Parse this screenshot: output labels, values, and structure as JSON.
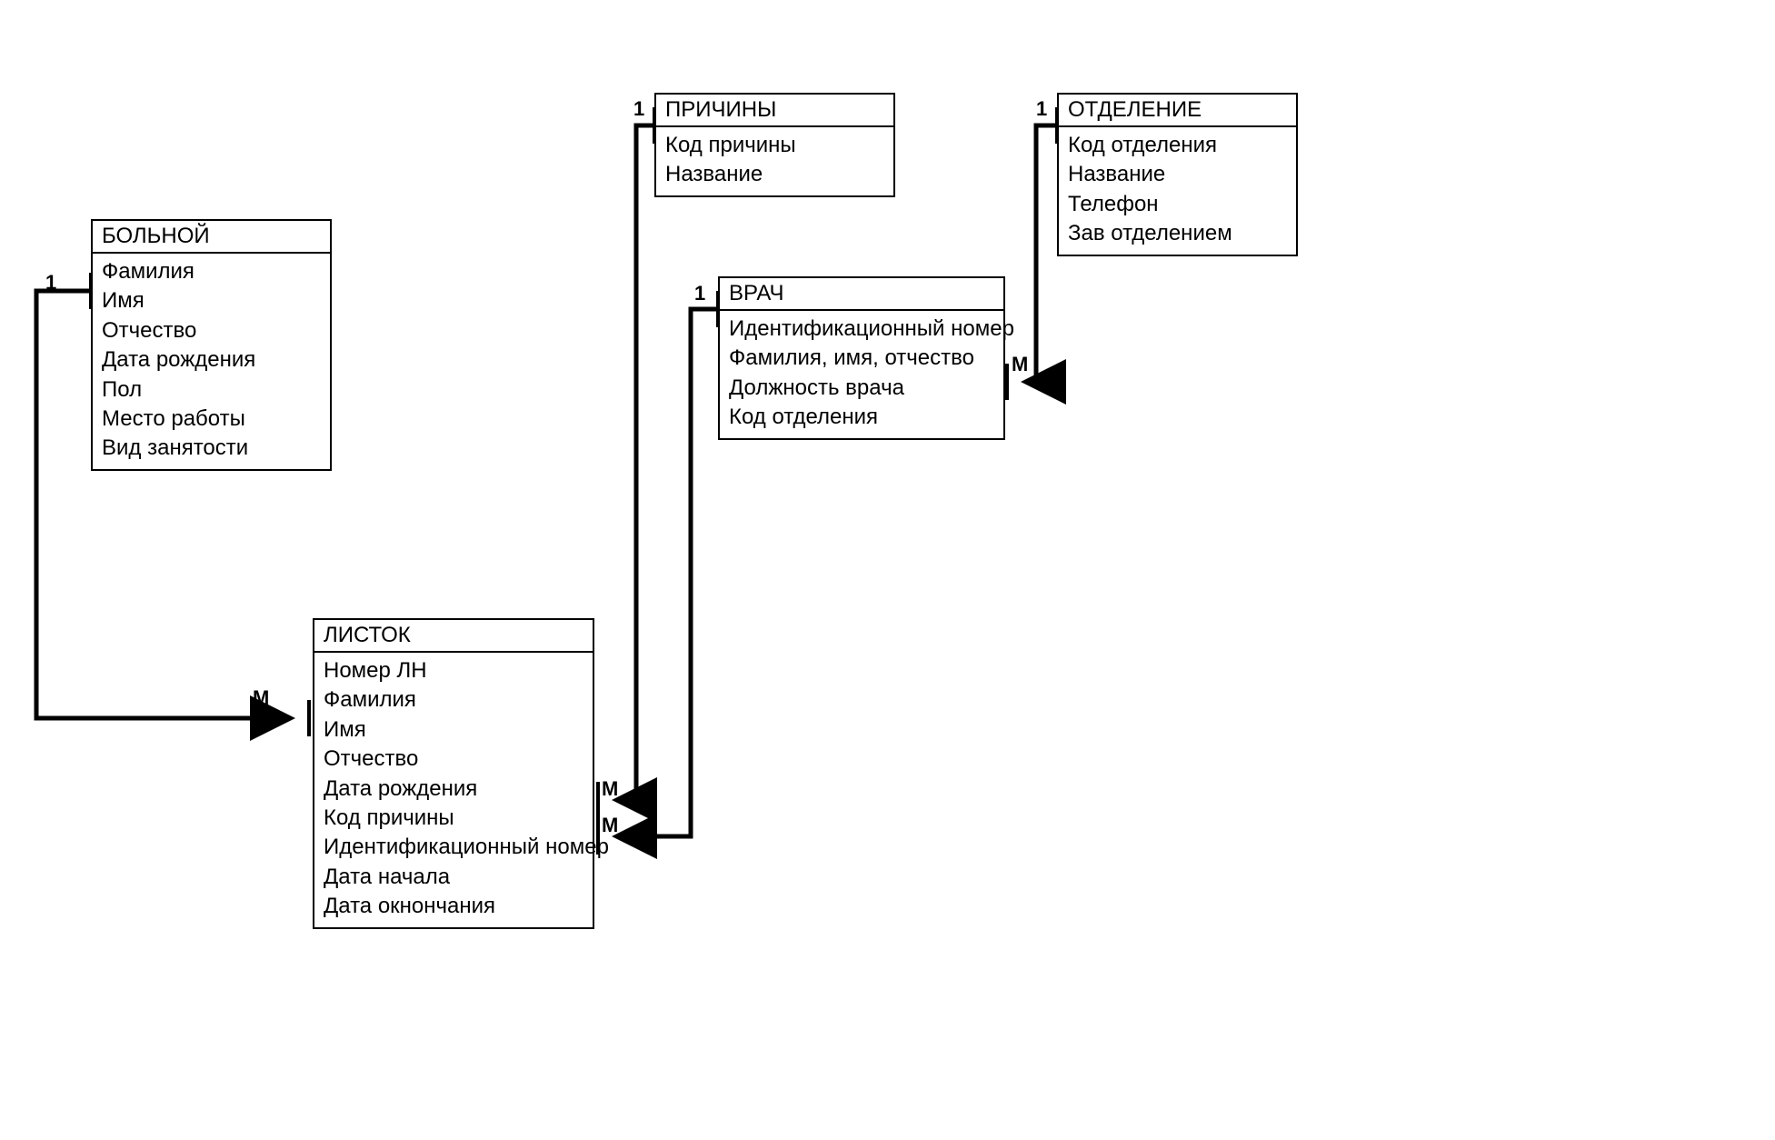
{
  "entities": {
    "bolnoy": {
      "title": "БОЛЬНОЙ",
      "attrs": [
        "Фамилия",
        "Имя",
        "Отчество",
        "Дата рождения",
        "Пол",
        "Место работы",
        "Вид занятости"
      ]
    },
    "prichiny": {
      "title": "ПРИЧИНЫ",
      "attrs": [
        "Код причины",
        "Название"
      ]
    },
    "otdelenie": {
      "title": "ОТДЕЛЕНИЕ",
      "attrs": [
        "Код отделения",
        "Название",
        "Телефон",
        "Зав отделением"
      ]
    },
    "vrach": {
      "title": "ВРАЧ",
      "attrs": [
        "Идентификационный номер",
        "Фамилия, имя, отчество",
        "Должность врача",
        "Код отделения"
      ]
    },
    "listok": {
      "title": "ЛИСТОК",
      "attrs": [
        "Номер ЛН",
        "Фамилия",
        "Имя",
        "Отчество",
        "Дата рождения",
        "Код причины",
        "Идентификационный номер",
        "Дата начала",
        "Дата окнончания"
      ]
    }
  },
  "cardinality": {
    "one": "1",
    "many": "М"
  },
  "relationships": [
    {
      "from": "bolnoy",
      "from_card": "1",
      "to": "listok",
      "to_card": "М"
    },
    {
      "from": "prichiny",
      "from_card": "1",
      "to": "listok",
      "to_card": "М"
    },
    {
      "from": "vrach",
      "from_card": "1",
      "to": "listok",
      "to_card": "М"
    },
    {
      "from": "otdelenie",
      "from_card": "1",
      "to": "vrach",
      "to_card": "М"
    }
  ]
}
